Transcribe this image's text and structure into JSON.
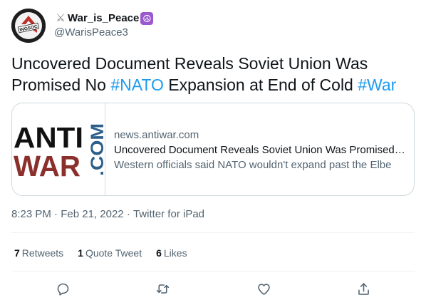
{
  "user": {
    "display_name": "War_is_Peace",
    "prefix_emoji_icon": "crossed-swords-icon",
    "suffix_emoji_icon": "peace-symbol-icon",
    "handle": "@WarisPeace3",
    "avatar_text": "INGSOC"
  },
  "tweet": {
    "text_parts": [
      {
        "text": "Uncovered Document Reveals Soviet Union Was Promised No ",
        "hashtag": false
      },
      {
        "text": "#NATO",
        "hashtag": true
      },
      {
        "text": " Expansion at End of Cold ",
        "hashtag": false
      },
      {
        "text": "#War",
        "hashtag": true
      }
    ]
  },
  "card": {
    "logo_line1": "ANTI",
    "logo_line2": "WAR",
    "logo_side": ".COM",
    "domain": "news.antiwar.com",
    "title": "Uncovered Document Reveals Soviet Union Was Promised No NATO Expansion at End of Cold War",
    "description": "Western officials said NATO wouldn't expand past the Elbe"
  },
  "meta": {
    "time": "8:23 PM",
    "separator": " · ",
    "date": "Feb 21, 2022",
    "source": "Twitter for iPad"
  },
  "stats": {
    "retweets_count": "7",
    "retweets_label": "Retweets",
    "quote_count": "1",
    "quote_label": "Quote Tweet",
    "likes_count": "6",
    "likes_label": "Likes"
  },
  "colors": {
    "hashtag": "#1d9bf0",
    "secondary_text": "#536471",
    "logo_black": "#111111",
    "logo_red": "#8b2f2c",
    "logo_blue": "#2e5f8a"
  }
}
